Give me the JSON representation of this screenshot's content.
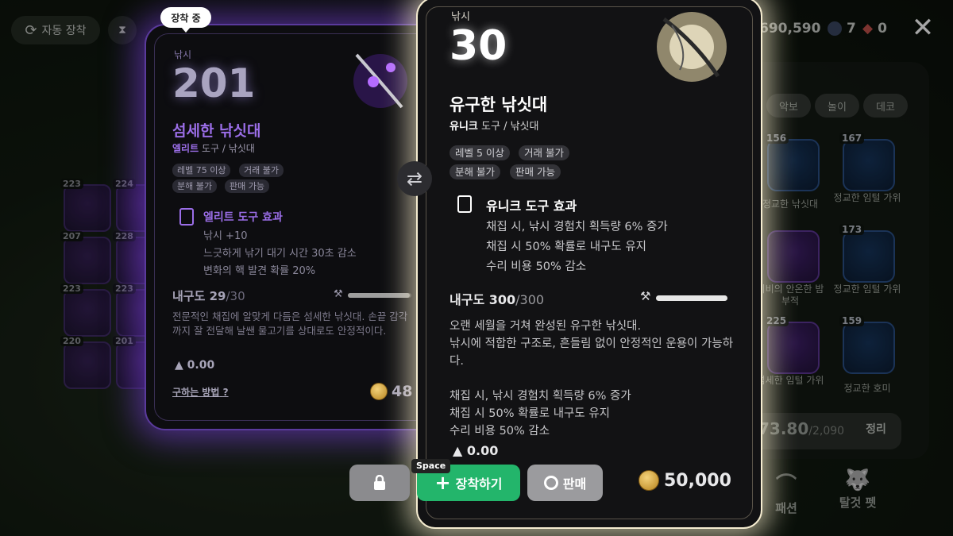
{
  "topbar": {
    "auto_equip_label": "자동 장착",
    "gold_amount": "690,590",
    "gem_count": "7",
    "token_count": "0"
  },
  "bg_inventory": {
    "tabs": [
      "악보",
      "놀이",
      "데코"
    ],
    "items": [
      {
        "level": "156",
        "label": "정교한 낚싯대"
      },
      {
        "level": "167",
        "label": "정교한 임털 가위"
      },
      {
        "level": "",
        "label": "이비의 안온한 밤 부적"
      },
      {
        "level": "173",
        "label": "정교한 임털 가위"
      },
      {
        "level": "225",
        "label": "섬세한 임털 가위"
      },
      {
        "level": "159",
        "label": "정교한 호미"
      }
    ],
    "left_levels": [
      "223",
      "224",
      "207",
      "228",
      "223",
      "223",
      "220",
      "201"
    ],
    "weight_current": "73.80",
    "weight_max": "/2,090",
    "sort_label": "정리",
    "nav": [
      {
        "icon": "hanger-icon",
        "label": "패션"
      },
      {
        "icon": "pet-icon",
        "label": "탈것 펫"
      }
    ]
  },
  "equipped_card": {
    "badge": "장착 중",
    "type": "낚시",
    "level": "201",
    "name": "섬세한 낚싯대",
    "grade": "엘리트",
    "category": " 도구 / 낚싯대",
    "tags": [
      "레벨 75 이상",
      "거래 불가",
      "분해 불가",
      "판매 가능"
    ],
    "effect_title": "엘리트 도구 효과",
    "effects": [
      "낚시 +10",
      "느긋하게 낚기 대기 시간 30초 감소",
      "변화의 핵 발견 확률 20%"
    ],
    "durability_label": "내구도 29",
    "durability_max": "/30",
    "durability_ratio": 0.97,
    "description": "전문적인 채집에 알맞게 다듬은 섬세한 낚싯대. 손끝 감각까지 잘 전달해 날쌘 물고기를 상대로도 안정적이다.",
    "weight": "0.00",
    "how_to_get": "구하는 방법",
    "price": "48"
  },
  "main_card": {
    "type": "낚시",
    "level": "30",
    "name": "유구한 낚싯대",
    "grade": "유니크",
    "category": " 도구 / 낚싯대",
    "tags": [
      "레벨 5 이상",
      "거래 불가",
      "분해 불가",
      "판매 가능"
    ],
    "effect_title": "유니크 도구 효과",
    "effects": [
      "채집 시, 낚시 경험치 획득량 6% 증가",
      "채집 시 50% 확률로 내구도 유지",
      "수리 비용 50% 감소"
    ],
    "durability_label": "내구도 300",
    "durability_max": "/300",
    "durability_ratio": 1.0,
    "description": "오랜 세월을 거쳐 완성된 유구한 낚싯대.\n낚시에 적합한 구조로, 흔들림 없이 안정적인 운용이 가능하다.\n\n채집 시, 낚시 경험치 획득량 6% 증가\n채집 시 50% 확률로 내구도 유지\n수리 비용 50% 감소",
    "weight": "0.00",
    "price": "50,000"
  },
  "actions": {
    "space_hint": "Space",
    "equip_label": "장착하기",
    "sell_label": "판매"
  },
  "colors": {
    "elite_purple": "#9b6ee8",
    "equip_green": "#23b56b",
    "unique_glow": "#f5ecd0"
  }
}
